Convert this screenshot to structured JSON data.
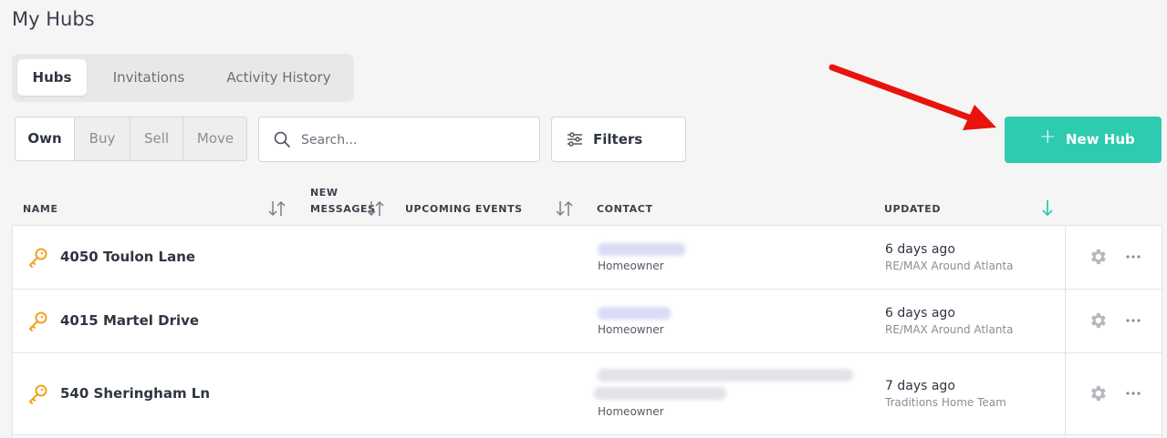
{
  "page": {
    "title": "My Hubs"
  },
  "tabs": [
    {
      "label": "Hubs",
      "active": true
    },
    {
      "label": "Invitations",
      "active": false
    },
    {
      "label": "Activity History",
      "active": false
    }
  ],
  "segments": [
    {
      "label": "Own",
      "active": true
    },
    {
      "label": "Buy",
      "active": false
    },
    {
      "label": "Sell",
      "active": false
    },
    {
      "label": "Move",
      "active": false
    }
  ],
  "search": {
    "placeholder": "Search...",
    "value": ""
  },
  "filters": {
    "label": "Filters"
  },
  "new_hub": {
    "label": "New Hub",
    "color": "#2ecbb1"
  },
  "annotation": {
    "arrow_color": "#e8130f"
  },
  "columns": {
    "name": "NAME",
    "new_messages_line1": "NEW",
    "new_messages_line2": "MESSAGES",
    "upcoming_events": "UPCOMING EVENTS",
    "contact": "CONTACT",
    "updated": "UPDATED"
  },
  "rows": [
    {
      "name": "4050 Toulon Lane",
      "contact_role": "Homeowner",
      "updated": "6 days ago",
      "agency": "RE/MAX Around Atlanta"
    },
    {
      "name": "4015 Martel Drive",
      "contact_role": "Homeowner",
      "updated": "6 days ago",
      "agency": "RE/MAX Around Atlanta"
    },
    {
      "name": "540 Sheringham Ln",
      "contact_role": "Homeowner",
      "updated": "7 days ago",
      "agency": "Traditions Home Team"
    }
  ],
  "accent_colors": {
    "key_icon": "#f0a31c",
    "sort_active": "#2ecbb1"
  }
}
